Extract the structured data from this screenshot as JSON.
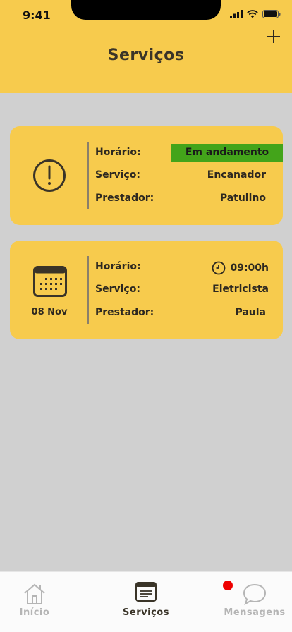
{
  "status_bar": {
    "time": "9:41"
  },
  "header": {
    "title": "Serviços",
    "add_icon": "plus-icon"
  },
  "cards": [
    {
      "icon": "alert-circle-icon",
      "rows": [
        {
          "label": "Horário:",
          "value": "Em andamento"
        },
        {
          "label": "Serviço:",
          "value": "Encanador"
        },
        {
          "label": "Prestador:",
          "value": "Patulino"
        }
      ],
      "status_color": "#43a41a"
    },
    {
      "icon": "calendar-icon",
      "date": "08 Nov",
      "rows": [
        {
          "label": "Horário:",
          "value": "09:00h",
          "icon": "clock-icon"
        },
        {
          "label": "Serviço:",
          "value": "Eletricista"
        },
        {
          "label": "Prestador:",
          "value": "Paula"
        }
      ]
    }
  ],
  "tab_bar": {
    "tabs": [
      {
        "label": "Início",
        "icon": "home-icon",
        "active": false
      },
      {
        "label": "Serviços",
        "icon": "services-icon",
        "active": true
      },
      {
        "label": "Mensagens",
        "icon": "chat-icon",
        "active": false,
        "badge": true
      }
    ]
  },
  "colors": {
    "accent": "#f7cb4d",
    "background": "#d0d0d0",
    "text": "#3a3428",
    "badge": "#e00000"
  }
}
